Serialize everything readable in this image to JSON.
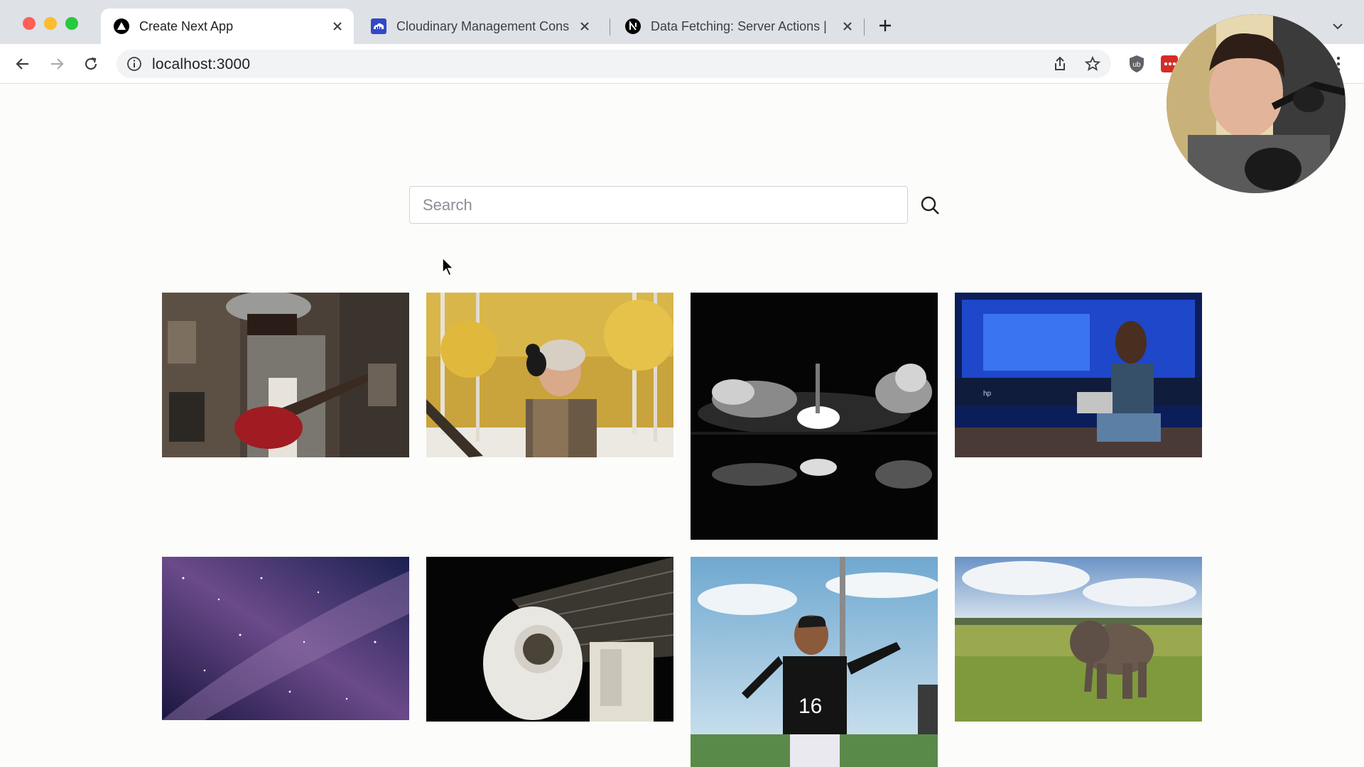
{
  "browser": {
    "tabs": [
      {
        "title": "Create Next App",
        "icon": "nextjs-triangle-icon",
        "active": true
      },
      {
        "title": "Cloudinary Management Cons",
        "icon": "cloudinary-icon",
        "active": false
      },
      {
        "title": "Data Fetching: Server Actions |",
        "icon": "nextjs-n-icon",
        "active": false
      }
    ],
    "address": "localhost:3000"
  },
  "page": {
    "search": {
      "placeholder": "Search",
      "value": ""
    },
    "images": [
      {
        "subject": "woman playing red guitar in record store"
      },
      {
        "subject": "man with cat on shoulder in autumn forest"
      },
      {
        "subject": "rocket launch at night reflected in water"
      },
      {
        "subject": "woman working on laptop on stage"
      },
      {
        "subject": "milky way starry night sky"
      },
      {
        "subject": "astronaut on space station"
      },
      {
        "subject": "soccer player number 16"
      },
      {
        "subject": "elephant in grassland"
      }
    ]
  },
  "colors": {
    "tabstrip": "#dee1e6",
    "page_background": "#fcfdfb",
    "traffic_red": "#fe5f57",
    "traffic_yellow": "#febc2e",
    "traffic_green": "#28c840"
  }
}
